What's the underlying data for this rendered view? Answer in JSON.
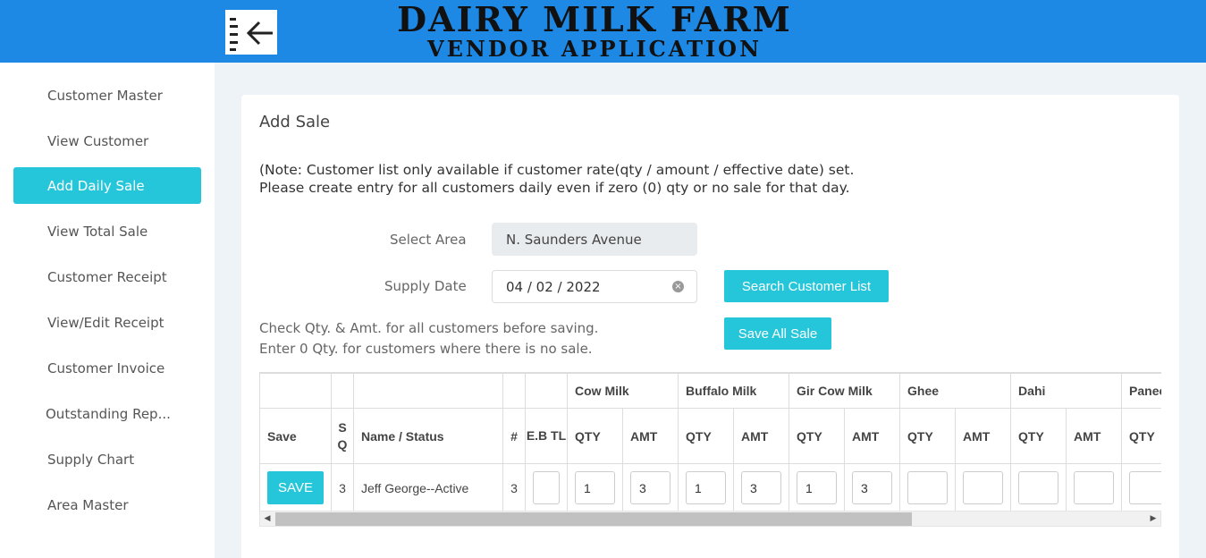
{
  "header": {
    "title": "DAIRY MILK FARM",
    "subtitle": "VENDOR APPLICATION",
    "menu_icon": "menu-collapse-arrow-icon",
    "bg_color": "#1e88e5"
  },
  "sidebar": {
    "items": [
      {
        "label": "Customer Master"
      },
      {
        "label": "View Customer"
      },
      {
        "label": "Add Daily Sale",
        "active": true
      },
      {
        "label": "View Total Sale"
      },
      {
        "label": "Customer Receipt"
      },
      {
        "label": "View/Edit Receipt"
      },
      {
        "label": "Customer Invoice"
      },
      {
        "label": "Outstanding Rep..."
      },
      {
        "label": "Supply Chart"
      },
      {
        "label": "Area Master"
      }
    ],
    "active_color": "#26c6da"
  },
  "page": {
    "title": "Add Sale",
    "note_line1": "(Note: Customer list only available if customer rate(qty / amount / effective date) set.",
    "note_line2": "Please create entry for all customers daily even if zero (0) qty or no sale for that day.",
    "select_area_label": "Select Area",
    "select_area_value": "N. Saunders Avenue",
    "supply_date_label": "Supply Date",
    "supply_date_value": "04 / 02 / 2022",
    "search_button": "Search Customer List",
    "save_all_button": "Save All Sale",
    "hint_line1": "Check Qty. & Amt. for all customers before saving.",
    "hint_line2": "Enter 0 Qty. for customers where there is no sale."
  },
  "table": {
    "products": [
      "Cow Milk",
      "Buffalo Milk",
      "Gir Cow Milk",
      "Ghee",
      "Dahi",
      "Paneer"
    ],
    "headers": {
      "save": "Save",
      "sq": "S Q",
      "name_status": "Name / Status",
      "num": "#",
      "ebtl": "E.B TL",
      "qty": "QTY",
      "amt": "AMT"
    },
    "rows": [
      {
        "save_label": "SAVE",
        "sq": "3",
        "name_status": "Jeff George--Active",
        "num": "3",
        "ebtl": "",
        "cow_qty": "1",
        "cow_amt": "3",
        "buffalo_qty": "1",
        "buffalo_amt": "3",
        "gir_qty": "1",
        "gir_amt": "3",
        "ghee_qty": "",
        "ghee_amt": "",
        "dahi_qty": "",
        "dahi_amt": "",
        "paneer_qty": ""
      }
    ]
  }
}
